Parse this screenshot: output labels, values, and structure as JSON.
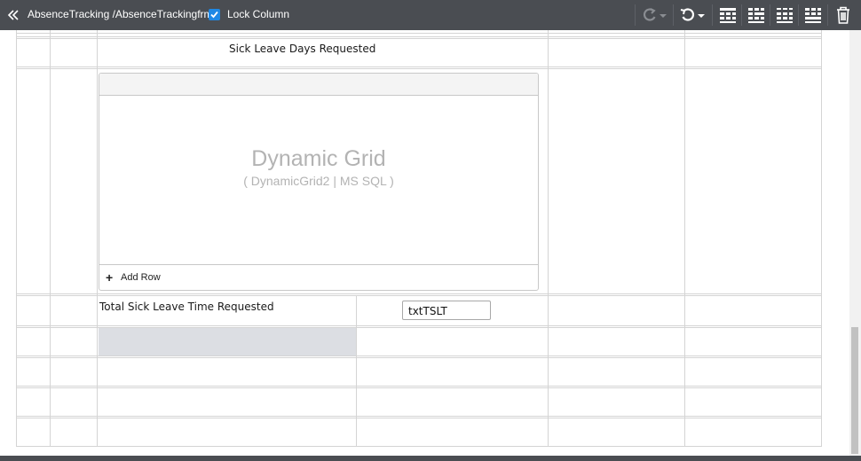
{
  "header": {
    "title": "AbsenceTracking /AbsenceTrackingfrm",
    "lock_column_label": "Lock Column",
    "lock_column_checked": true
  },
  "toolbar": {
    "buttons": [
      "redo-icon",
      "undo-icon",
      "layout-grid-1-icon",
      "layout-grid-2-icon",
      "layout-grid-3-icon",
      "layout-grid-4-icon",
      "trash-icon"
    ]
  },
  "form": {
    "sick_leave_days_label": "Sick Leave Days Requested",
    "total_sick_leave_label": "Total Sick Leave Time Requested",
    "txt_tslt_value": "txtTSLT"
  },
  "dynamic_grid": {
    "title": "Dynamic Grid",
    "subtitle": "( DynamicGrid2 | MS SQL )",
    "add_row_label": "Add Row"
  },
  "colors": {
    "topbar": "#4a4d52",
    "checkbox": "#1e88e5",
    "grid_line": "#d4d4d4",
    "selected_cell": "#dcdee3",
    "placeholder_text": "#b3b3b3"
  }
}
